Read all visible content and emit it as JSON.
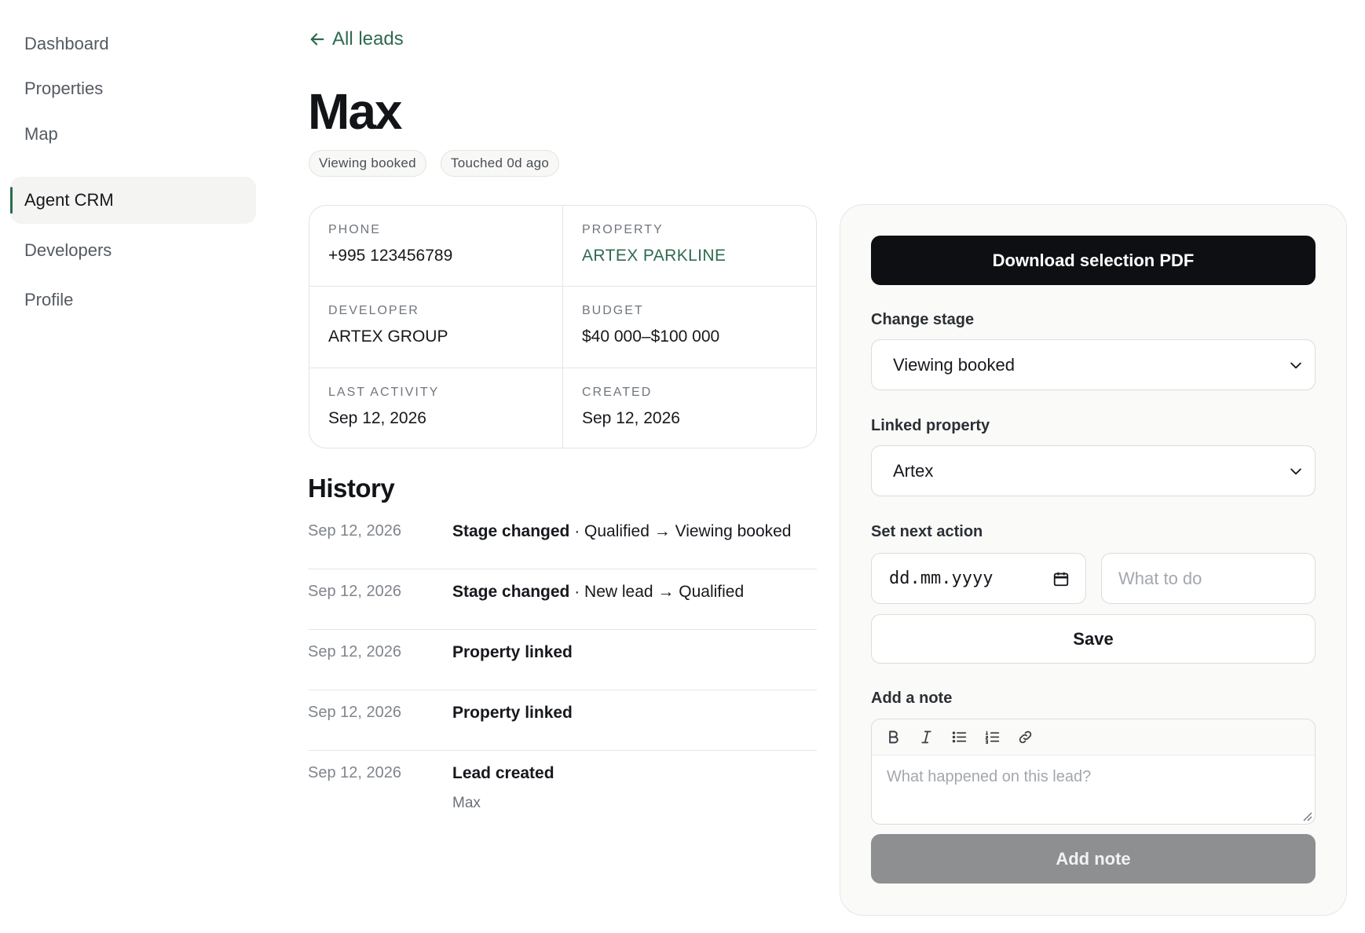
{
  "sidebar": {
    "items": [
      {
        "label": "Dashboard"
      },
      {
        "label": "Properties"
      },
      {
        "label": "Map"
      },
      {
        "label": "Agent CRM",
        "active": true
      },
      {
        "label": "Developers"
      },
      {
        "label": "Profile"
      }
    ]
  },
  "header": {
    "back_label": "All leads",
    "title": "Max",
    "badges": [
      "Viewing booked",
      "Touched 0d ago"
    ]
  },
  "details": {
    "phone": {
      "label": "Phone",
      "value": "+995 123456789"
    },
    "property": {
      "label": "Property",
      "value": "ARTEX PARKLINE"
    },
    "developer": {
      "label": "Developer",
      "value": "ARTEX GROUP"
    },
    "budget": {
      "label": "Budget",
      "value": "$40 000–$100 000"
    },
    "last_activity": {
      "label": "Last activity",
      "value": "Sep 12, 2026"
    },
    "created": {
      "label": "Created",
      "value": "Sep 12, 2026"
    }
  },
  "history": {
    "title": "History",
    "rows": [
      {
        "date": "Sep 12, 2026",
        "event": "Stage changed",
        "detail": " · Qualified → Viewing booked",
        "sub": ""
      },
      {
        "date": "Sep 12, 2026",
        "event": "Stage changed",
        "detail": " · New lead → Qualified",
        "sub": ""
      },
      {
        "date": "Sep 12, 2026",
        "event": "Property linked",
        "detail": "",
        "sub": ""
      },
      {
        "date": "Sep 12, 2026",
        "event": "Property linked",
        "detail": "",
        "sub": ""
      },
      {
        "date": "Sep 12, 2026",
        "event": "Lead created",
        "detail": "",
        "sub": "Max"
      }
    ]
  },
  "panel": {
    "download_label": "Download selection PDF",
    "stage": {
      "label": "Change stage",
      "value": "Viewing booked"
    },
    "linked_property": {
      "label": "Linked property",
      "value": "Artex"
    },
    "next_action": {
      "label": "Set next action",
      "date_placeholder": "dd.mm.yyyy",
      "todo_placeholder": "What to do"
    },
    "save_label": "Save",
    "note": {
      "label": "Add a note",
      "placeholder": "What happened on this lead?",
      "button_label": "Add note"
    }
  },
  "colors": {
    "accent": "#2e6a4f",
    "primary_button": "#0d0f12",
    "disabled_button": "#8e8f91"
  }
}
